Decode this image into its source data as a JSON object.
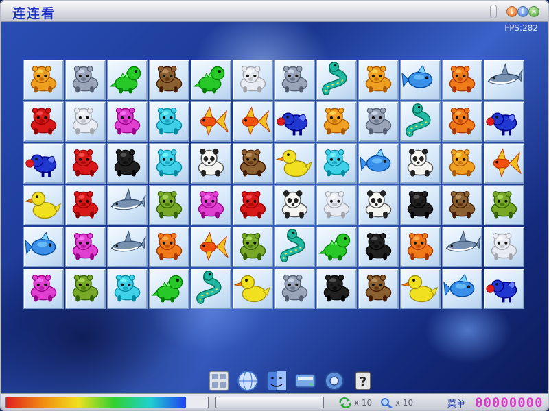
{
  "window": {
    "title": "连连看",
    "buttons": [
      {
        "name": "minimize",
        "glyph": "↓",
        "color": "#e0621a"
      },
      {
        "name": "info",
        "glyph": "↑",
        "color": "#3c6fd0"
      },
      {
        "name": "close",
        "glyph": "×",
        "color": "#3f9d2a"
      }
    ]
  },
  "hud": {
    "fps": "FPS:282"
  },
  "board": {
    "rows": 6,
    "cols": 12,
    "tiles": [
      [
        "tiger",
        "hippo",
        "dino",
        "bear",
        "dino",
        "rabbit",
        "hippo",
        "snake",
        "tiger",
        "fish",
        "lion",
        "shark"
      ],
      [
        "cow",
        "rabbit",
        "pig",
        "elephant",
        "goldfish",
        "goldfish",
        "bird",
        "tiger",
        "hippo",
        "snake",
        "lion",
        "bird"
      ],
      [
        "bird",
        "cow",
        "cat",
        "elephant",
        "panda",
        "bear",
        "duck",
        "elephant",
        "fish",
        "panda",
        "tiger",
        "goldfish"
      ],
      [
        "duck",
        "cow",
        "shark",
        "rhino",
        "pig",
        "cow",
        "panda",
        "rabbit",
        "panda",
        "cat",
        "bear",
        "rhino"
      ],
      [
        "fish",
        "pig",
        "shark",
        "lion",
        "goldfish",
        "rhino",
        "snake",
        "dino",
        "cat",
        "lion",
        "shark",
        "rabbit"
      ],
      [
        "pig",
        "rhino",
        "elephant",
        "dino",
        "snake",
        "duck",
        "hippo",
        "cat",
        "bear",
        "duck",
        "fish",
        "bird"
      ]
    ]
  },
  "animals": {
    "tiger": {
      "color": "#f0a020",
      "shape": "quad"
    },
    "hippo": {
      "color": "#9aa4b8",
      "shape": "quad"
    },
    "dino": {
      "color": "#28c828",
      "shape": "dino"
    },
    "bear": {
      "color": "#8a6030",
      "shape": "quad"
    },
    "rabbit": {
      "color": "#e8ecf2",
      "shape": "quad"
    },
    "snake": {
      "color": "#20b8a0",
      "shape": "snake"
    },
    "fish": {
      "color": "#3a90e8",
      "shape": "fish"
    },
    "lion": {
      "color": "#f07a18",
      "shape": "quad"
    },
    "shark": {
      "color": "#7890b0",
      "shape": "shark"
    },
    "cow": {
      "color": "#d81818",
      "shape": "quad"
    },
    "pig": {
      "color": "#e040d0",
      "shape": "quad"
    },
    "elephant": {
      "color": "#40d0e8",
      "shape": "quad"
    },
    "goldfish": {
      "color": "#f05010",
      "shape": "goldfish"
    },
    "bird": {
      "color": "#2038d0",
      "shape": "bird"
    },
    "cat": {
      "color": "#202020",
      "shape": "quad"
    },
    "panda": {
      "color": "#f4f4f0",
      "shape": "panda"
    },
    "duck": {
      "color": "#f0e020",
      "shape": "duck"
    },
    "rhino": {
      "color": "#78a828",
      "shape": "quad"
    }
  },
  "dock": [
    {
      "name": "control-panel",
      "color": "#6d7384"
    },
    {
      "name": "network-globe",
      "color": "#3c6fd0"
    },
    {
      "name": "finder-face",
      "color": "#4a80e0"
    },
    {
      "name": "drive",
      "color": "#7aa8e8"
    },
    {
      "name": "settings-gear",
      "color": "#5b8fd8"
    },
    {
      "name": "help",
      "color": "#e6e6e6",
      "glyph": "?"
    }
  ],
  "status": {
    "time_fraction": 0.89,
    "refresh_count": "x 10",
    "hint_count": "x 10",
    "menu_label": "菜单",
    "score": "00000000"
  }
}
